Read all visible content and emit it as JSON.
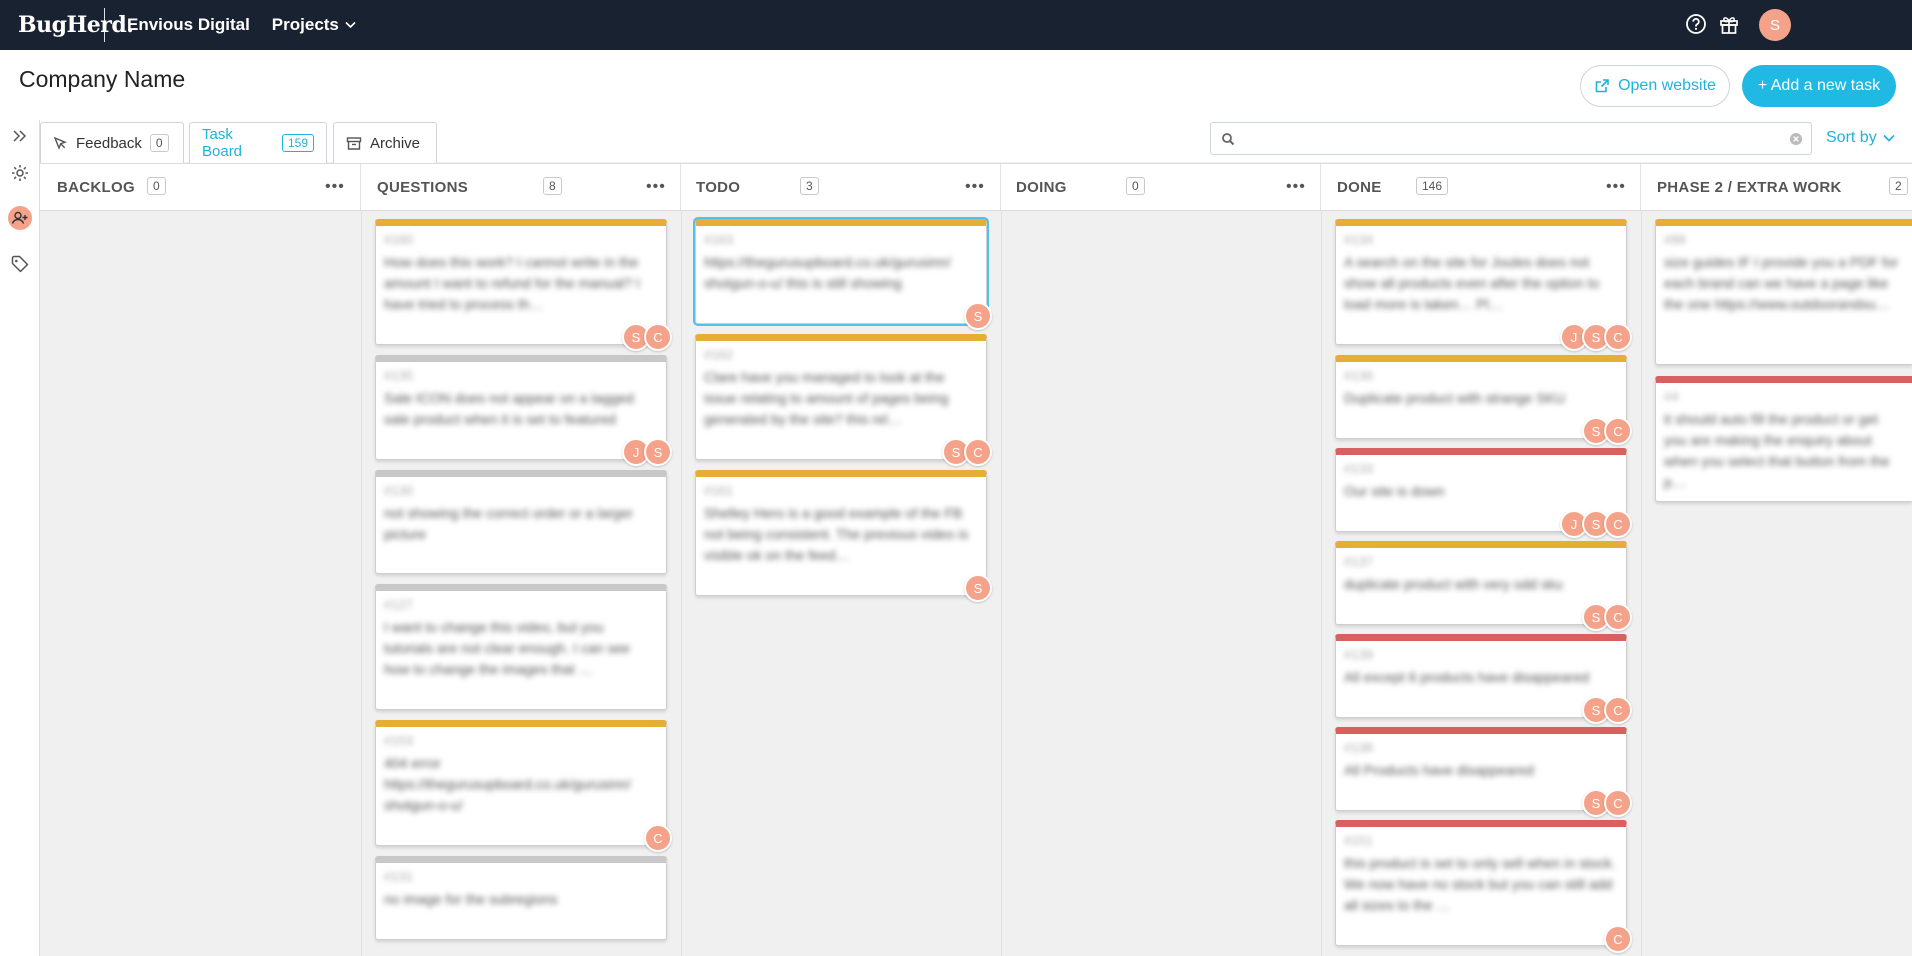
{
  "app": {
    "logo": "BugHerd.",
    "org": "Envious Digital",
    "projects_label": "Projects",
    "user_initial": "S",
    "accent": "#1fb9e3",
    "nav_bg": "#192230"
  },
  "header": {
    "title": "Company Name",
    "open_website": "Open website",
    "add_task": "+ Add a new task"
  },
  "tabs": [
    {
      "label": "Feedback",
      "count": "0"
    },
    {
      "label": "Task Board",
      "count": "159"
    },
    {
      "label": "Archive"
    }
  ],
  "search": {
    "placeholder": "",
    "value": ""
  },
  "sort_label": "Sort by",
  "columns": [
    {
      "name": "BACKLOG",
      "count": "0"
    },
    {
      "name": "QUESTIONS",
      "count": "8"
    },
    {
      "name": "TODO",
      "count": "3"
    },
    {
      "name": "DOING",
      "count": "0"
    },
    {
      "name": "DONE",
      "count": "146"
    },
    {
      "name": "PHASE 2 / EXTRA WORK",
      "count": "2"
    }
  ],
  "cards": {
    "q1": {
      "id": "#160",
      "text": "How does this work? I cannot write in the amount I want to refund for the manual? I have tried to process th…",
      "av1": "S",
      "av2": "C"
    },
    "q2": {
      "id": "#135",
      "text": "Sale ICON does not appear on a tagged sale product when it is set to featured",
      "av1": "J",
      "av2": "S"
    },
    "q3": {
      "id": "#130",
      "text": "not showing the correct order or a larger picture"
    },
    "q4": {
      "id": "#127",
      "text": "I want to change this video, but you tutorials are not clear enough. I can see how to change the images that …"
    },
    "q5": {
      "id": "#153",
      "text": "404 error https://thegurusupboard.co.uk/gurusinn/ shotgun-o-u/",
      "av1": "C"
    },
    "q6": {
      "id": "#131",
      "text": "no image for the subregions"
    },
    "t1": {
      "id": "#163",
      "text": "https://thegurusupboard.co.uk/gurusinn/ shotgun-o-u/ this is still showing",
      "av1": "S"
    },
    "t2": {
      "id": "#162",
      "text": "Clare have you managed to look at the issue relating to amount of pages being generated by the site? this rel…",
      "av1": "S",
      "av2": "C"
    },
    "t3": {
      "id": "#161",
      "text": "Shelley Hero is a good example of the FB not being consistent. The previous video is visible ok on the feed…",
      "av1": "S"
    },
    "d1": {
      "id": "#134",
      "text": "A search on the site for Joules does not show all products even after the option to load more is taken… Pl…",
      "av1": "J",
      "av2": "S",
      "av3": "C"
    },
    "d2": {
      "id": "#136",
      "text": "Duplicate product with strange SKU",
      "av1": "S",
      "av2": "C"
    },
    "d3": {
      "id": "#133",
      "text": "Our site is down",
      "av1": "J",
      "av2": "S",
      "av3": "C"
    },
    "d4": {
      "id": "#137",
      "text": "duplicate product with very odd sku",
      "av1": "S",
      "av2": "C"
    },
    "d5": {
      "id": "#139",
      "text": "All except 6 products have disappeared",
      "av1": "S",
      "av2": "C"
    },
    "d6": {
      "id": "#138",
      "text": "All Products have disappeared",
      "av1": "S",
      "av2": "C"
    },
    "d7": {
      "id": "#151",
      "text": "this product is set to only sell when in stock. We now have no stock but you can still add all sizes to the …",
      "av1": "C"
    },
    "p1": {
      "id": "#88",
      "text": "size guides IF I provide you a PDF for each brand can we have a page like the one https://www.outdoorandsu…"
    },
    "p2": {
      "id": "#4",
      "text": "it should auto fill the product or get you are making the enquiry about when you select that button from the p…"
    }
  }
}
